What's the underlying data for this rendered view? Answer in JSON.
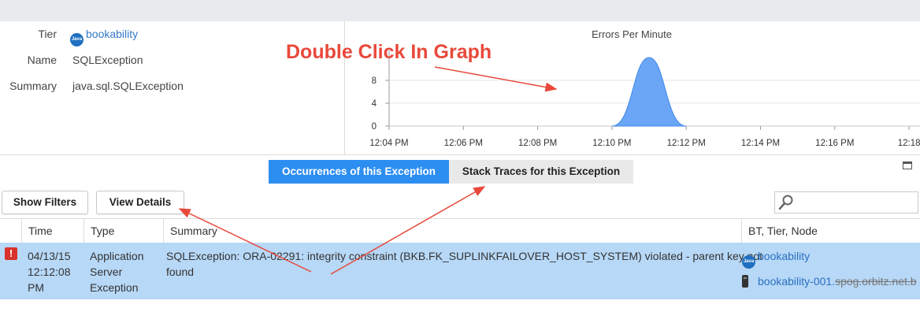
{
  "details": {
    "tier_label": "Tier",
    "tier_badge": "Java",
    "tier_value": "bookability",
    "name_label": "Name",
    "name_value": "SQLException",
    "summary_label": "Summary",
    "summary_value": "java.sql.SQLException"
  },
  "annotation": "Double Click In Graph",
  "chart_data": {
    "type": "area",
    "title": "Errors Per Minute",
    "x_ticks": [
      "12:04 PM",
      "12:06 PM",
      "12:08 PM",
      "12:10 PM",
      "12:12 PM",
      "12:14 PM",
      "12:16 PM",
      "12:18"
    ],
    "y_ticks": [
      0,
      4,
      8
    ],
    "ylim": [
      0,
      12
    ],
    "series": [
      {
        "x": [
          "12:10 PM",
          "12:11 PM",
          "12:12 PM"
        ],
        "y": [
          0,
          12,
          0
        ]
      }
    ],
    "colors": {
      "fill": "#6aa6f5",
      "stroke": "#3f87ea"
    },
    "grid": "horizontal"
  },
  "tabs": {
    "occurrences": "Occurrences of this Exception",
    "stack_traces": "Stack Traces for this Exception"
  },
  "toolbar": {
    "show_filters": "Show Filters",
    "view_details": "View Details",
    "search_placeholder": ""
  },
  "table": {
    "headers": {
      "time": "Time",
      "type": "Type",
      "summary": "Summary",
      "bt": "BT, Tier, Node"
    },
    "row": {
      "time_1": "04/13/15",
      "time_2": "12:12:08",
      "time_3": "PM",
      "type_1": "Application",
      "type_2": "Server",
      "type_3": "Exception",
      "summary_1": "SQLException: ORA-02291: integrity constraint (BKB.FK_SUPLINKFAILOVER_HOST_SYSTEM) violated - parent key not",
      "summary_2": "found",
      "bt_badge": "Java",
      "bt_tier": "bookability",
      "node_visible": "bookability-001.",
      "node_struck": "spog.orbitz.net.b"
    }
  }
}
